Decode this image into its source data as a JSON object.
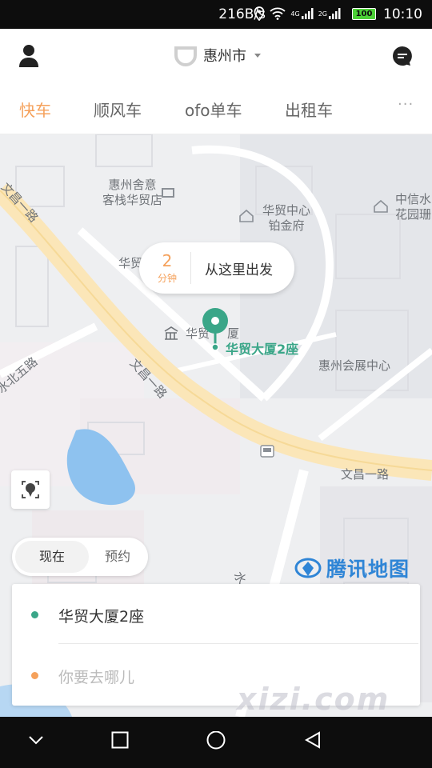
{
  "status_bar": {
    "net_speed": "216B/s",
    "signal1_label": "4G",
    "signal2_label": "2G",
    "battery": "100",
    "time": "10:10"
  },
  "header": {
    "city": "惠州市",
    "profile_icon": "person-icon",
    "message_icon": "chat-bubble-icon",
    "logo_icon": "didi-logo-icon"
  },
  "tabs": [
    {
      "label": "快车",
      "active": true
    },
    {
      "label": "顺风车",
      "active": false
    },
    {
      "label": "ofo单车",
      "active": false
    },
    {
      "label": "出租车",
      "active": false
    }
  ],
  "tabs_more": "···",
  "map": {
    "labels": {
      "hotel": "惠州舍意\n客栈华贸店",
      "center": "华贸中心\n铂金府",
      "zhongxin": "中信水\n花园珊",
      "hua_partial": "华贸",
      "poi_small": "华贸",
      "poi_small_tail": "厦",
      "road_wenchang_top": "文昌一路",
      "road_wenchang_mid": "文昌一路",
      "road_wenchang_right": "文昌一路",
      "road_shuibei": "水北五路",
      "expo": "惠州会展中心",
      "road_bottom": "水"
    },
    "eta_value": "2",
    "eta_unit": "分钟",
    "pickup_action": "从这里出发",
    "poi_name": "华贸大厦2座",
    "provider": "腾讯地图"
  },
  "time_toggle": {
    "now": "现在",
    "book": "预约"
  },
  "address": {
    "from": "华贸大厦2座",
    "to_placeholder": "你要去哪儿"
  },
  "watermark": "xizi.com",
  "colors": {
    "accent_orange": "#f5a15b",
    "accent_green": "#3aa688",
    "tencent_blue": "#2f85d6"
  }
}
